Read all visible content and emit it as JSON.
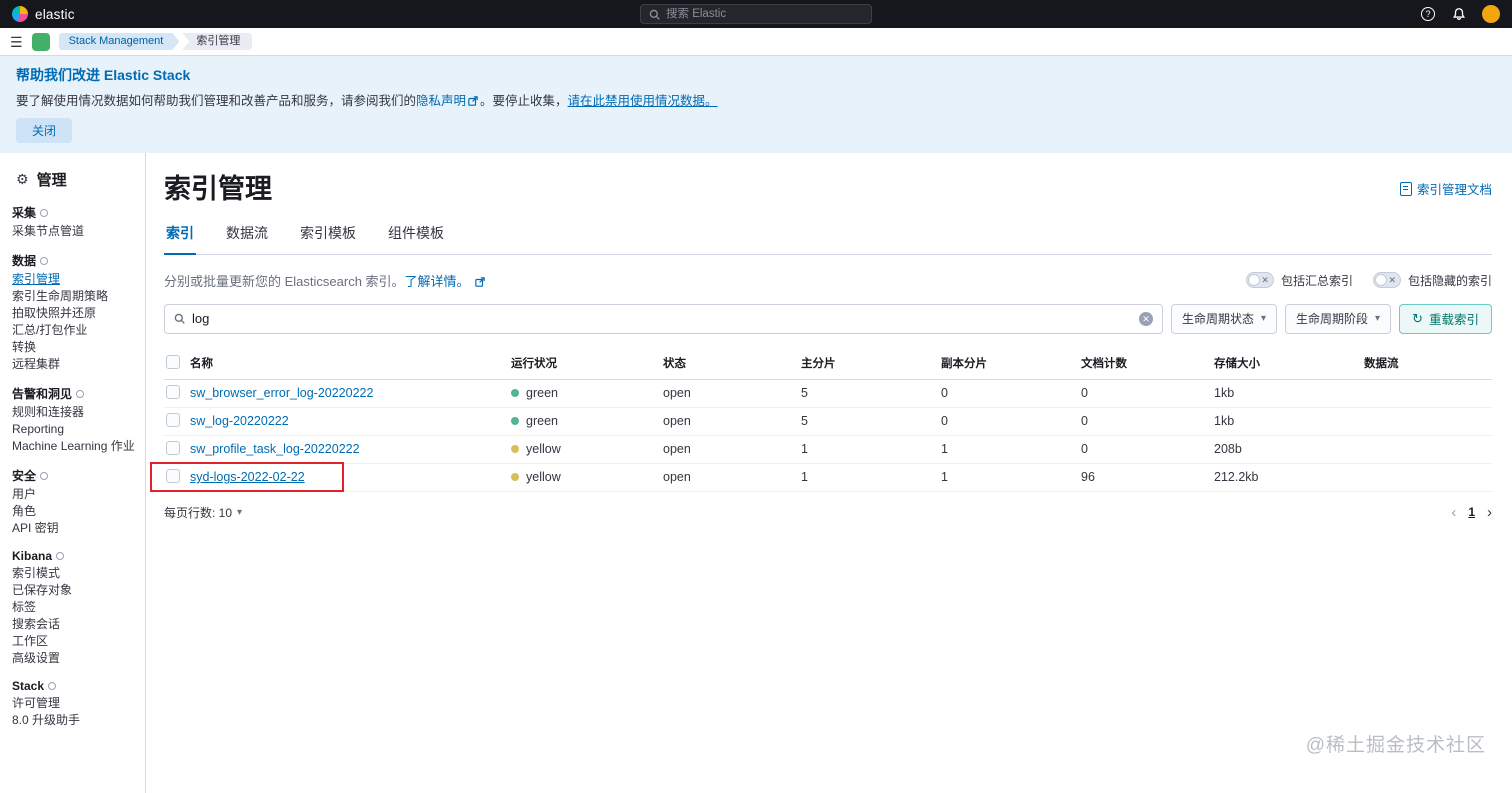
{
  "topbar": {
    "brand": "elastic",
    "search_placeholder": "搜索 Elastic"
  },
  "breadcrumbs": {
    "items": [
      "Stack Management",
      "索引管理"
    ]
  },
  "banner": {
    "title": "帮助我们改进 Elastic Stack",
    "body_prefix": "要了解使用情况数据如何帮助我们管理和改善产品和服务，请参阅我们的",
    "privacy_link": "隐私声明",
    "body_middle": "。要停止收集，",
    "disable_link": "请在此禁用使用情况数据。",
    "close_button": "关闭"
  },
  "sidebar": {
    "title": "管理",
    "sections": [
      {
        "header": "采集",
        "items": [
          {
            "label": "采集节点管道"
          }
        ]
      },
      {
        "header": "数据",
        "items": [
          {
            "label": "索引管理",
            "active": true
          },
          {
            "label": "索引生命周期策略"
          },
          {
            "label": "拍取快照并还原"
          },
          {
            "label": "汇总/打包作业"
          },
          {
            "label": "转换"
          },
          {
            "label": "远程集群"
          }
        ]
      },
      {
        "header": "告警和洞见",
        "items": [
          {
            "label": "规则和连接器"
          },
          {
            "label": "Reporting"
          },
          {
            "label": "Machine Learning 作业"
          }
        ]
      },
      {
        "header": "安全",
        "items": [
          {
            "label": "用户"
          },
          {
            "label": "角色"
          },
          {
            "label": "API 密钥"
          }
        ]
      },
      {
        "header": "Kibana",
        "items": [
          {
            "label": "索引模式"
          },
          {
            "label": "已保存对象"
          },
          {
            "label": "标签"
          },
          {
            "label": "搜索会话"
          },
          {
            "label": "工作区"
          },
          {
            "label": "高级设置"
          }
        ]
      },
      {
        "header": "Stack",
        "items": [
          {
            "label": "许可管理"
          },
          {
            "label": "8.0 升级助手"
          }
        ]
      }
    ]
  },
  "main": {
    "title": "索引管理",
    "docs_link": "索引管理文档",
    "tabs": [
      {
        "label": "索引",
        "active": true
      },
      {
        "label": "数据流"
      },
      {
        "label": "索引模板"
      },
      {
        "label": "组件模板"
      }
    ],
    "description": "分别或批量更新您的 Elasticsearch 索引。",
    "learn_more": "了解详情。",
    "toggles": [
      {
        "label": "包括汇总索引",
        "on": false
      },
      {
        "label": "包括隐藏的索引",
        "on": false
      }
    ],
    "search": {
      "value": "log"
    },
    "filters": [
      {
        "label": "生命周期状态"
      },
      {
        "label": "生命周期阶段"
      }
    ],
    "reload_button": "重载索引",
    "table": {
      "columns": [
        "名称",
        "运行状况",
        "状态",
        "主分片",
        "副本分片",
        "文档计数",
        "存储大小",
        "数据流"
      ],
      "rows": [
        {
          "name": "sw_browser_error_log-20220222",
          "health": "green",
          "status": "open",
          "primaries": "5",
          "replicas": "0",
          "docs": "0",
          "size": "1kb",
          "data_stream": "",
          "annotated": false
        },
        {
          "name": "sw_log-20220222",
          "health": "green",
          "status": "open",
          "primaries": "5",
          "replicas": "0",
          "docs": "0",
          "size": "1kb",
          "data_stream": "",
          "annotated": false
        },
        {
          "name": "sw_profile_task_log-20220222",
          "health": "yellow",
          "status": "open",
          "primaries": "1",
          "replicas": "1",
          "docs": "0",
          "size": "208b",
          "data_stream": "",
          "annotated": false
        },
        {
          "name": "syd-logs-2022-02-22",
          "health": "yellow",
          "status": "open",
          "primaries": "1",
          "replicas": "1",
          "docs": "96",
          "size": "212.2kb",
          "data_stream": "",
          "annotated": true
        }
      ]
    },
    "pagination": {
      "rows_per_page_label": "每页行数: 10",
      "page": "1"
    }
  },
  "icons": {
    "hamburger": "☰",
    "gear": "⚙",
    "close": "✕",
    "refresh": "↻",
    "chevron_down": "▾",
    "chevron_left": "‹",
    "chevron_right": "›",
    "help": "?"
  },
  "colors": {
    "accent": "#006bb4",
    "teal": "#00a69b",
    "health_green": "#54b399",
    "health_yellow": "#d6bf57",
    "annotation_red": "#e0232a",
    "banner_bg": "#e8f2fb",
    "header_bg": "#16171c"
  },
  "watermark": "@稀土掘金技术社区"
}
